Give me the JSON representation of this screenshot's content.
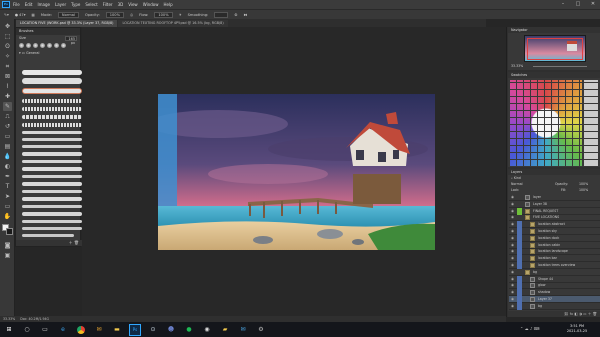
{
  "menubar": {
    "items": [
      "File",
      "Edit",
      "Image",
      "Layer",
      "Type",
      "Select",
      "Filter",
      "3D",
      "View",
      "Window",
      "Help"
    ]
  },
  "options": {
    "size": "47",
    "mode_label": "Mode:",
    "mode_value": "Normal",
    "opacity_label": "Opacity:",
    "opacity_value": "100%",
    "flow_label": "Flow:",
    "flow_value": "100%",
    "smoothing_label": "Smoothing:"
  },
  "tabs": [
    {
      "label": "LOCATION FIVE (WORK.psd @ 33.3% (Layer 37, RGB/8)",
      "active": true
    },
    {
      "label": "LOCATION TEXTING ROOFTOP 4PY.psd @ 16.5% (bg, RGB/8)",
      "active": false
    }
  ],
  "brush_panel": {
    "title": "Brushes",
    "size_label": "Size",
    "size_value": "165 px",
    "group_label": "General"
  },
  "navigator": {
    "title": "Navigator",
    "zoom": "33.33%"
  },
  "swatches": {
    "title": "Swatches"
  },
  "layers": {
    "title": "Layers",
    "kind_label": "Kind",
    "blend_mode": "Normal",
    "opacity_label": "Opacity:",
    "opacity": "100%",
    "lock_label": "Lock:",
    "fill_label": "Fill:",
    "fill": "100%",
    "rows": [
      {
        "name": "layer",
        "indent": 0,
        "group": false,
        "tag": "",
        "selected": false
      },
      {
        "name": "Layer 38",
        "indent": 0,
        "group": false,
        "tag": "",
        "selected": false
      },
      {
        "name": "FINAL REQUEST",
        "indent": 0,
        "group": true,
        "tag": "#6fbf3a",
        "selected": false
      },
      {
        "name": "FIVE LOCATIONS",
        "indent": 0,
        "group": true,
        "tag": "",
        "selected": false
      },
      {
        "name": "location abstract",
        "indent": 1,
        "group": true,
        "tag": "#4f6fb0",
        "selected": false
      },
      {
        "name": "location sky",
        "indent": 1,
        "group": true,
        "tag": "#4f6fb0",
        "selected": false
      },
      {
        "name": "location dock",
        "indent": 1,
        "group": true,
        "tag": "#4f6fb0",
        "selected": false
      },
      {
        "name": "location cabin",
        "indent": 1,
        "group": true,
        "tag": "#4f6fb0",
        "selected": false
      },
      {
        "name": "location landscape",
        "indent": 1,
        "group": true,
        "tag": "#4f6fb0",
        "selected": false
      },
      {
        "name": "location bar",
        "indent": 1,
        "group": true,
        "tag": "#4f6fb0",
        "selected": false
      },
      {
        "name": "location trees overview",
        "indent": 1,
        "group": true,
        "tag": "#4f6fb0",
        "selected": false
      },
      {
        "name": "bg",
        "indent": 0,
        "group": true,
        "tag": "",
        "selected": false
      },
      {
        "name": "Shape 44",
        "indent": 1,
        "group": false,
        "tag": "#4f6fb0",
        "selected": false
      },
      {
        "name": "glow",
        "indent": 1,
        "group": false,
        "tag": "#4f6fb0",
        "selected": false
      },
      {
        "name": "shadow",
        "indent": 1,
        "group": false,
        "tag": "#4f6fb0",
        "selected": false
      },
      {
        "name": "Layer 37",
        "indent": 1,
        "group": false,
        "tag": "#4f6fb0",
        "selected": true
      },
      {
        "name": "bg",
        "indent": 1,
        "group": false,
        "tag": "#4f6fb0",
        "selected": false
      }
    ]
  },
  "status": {
    "zoom": "33.33%",
    "doc": "Doc: 40.2M/1.94G"
  },
  "taskbar": {
    "icons": [
      "windows-start",
      "search",
      "task-view",
      "edge",
      "chrome",
      "mail",
      "file-explorer",
      "photoshop",
      "steam",
      "discord",
      "spotify",
      "obs",
      "folder",
      "mail-2",
      "settings"
    ],
    "time": "3:51 PM",
    "date": "2021-03-25"
  }
}
